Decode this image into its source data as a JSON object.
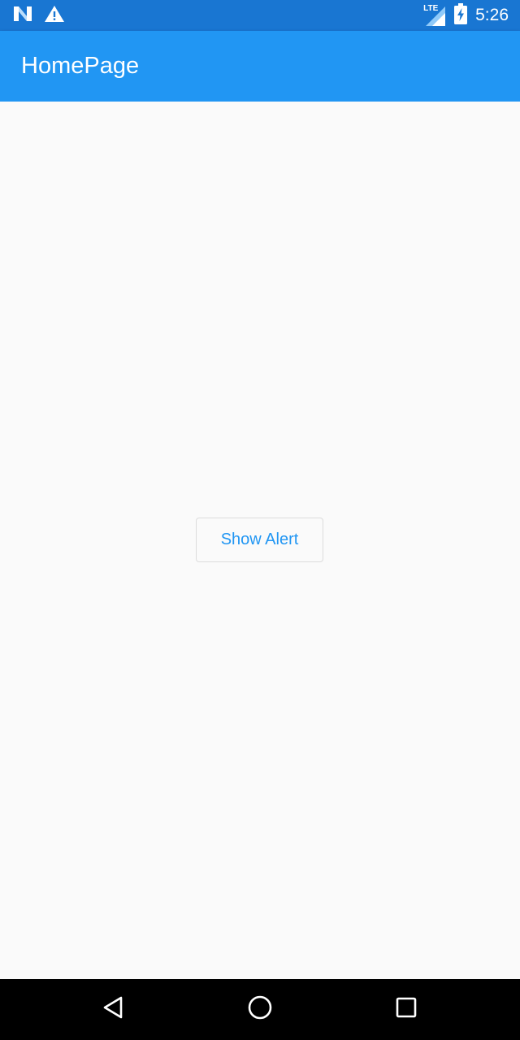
{
  "status_bar": {
    "time": "5:26",
    "network_label": "LTE",
    "icons": [
      "n-logo-icon",
      "warning-icon",
      "lte-signal-icon",
      "battery-charging-icon"
    ]
  },
  "app_bar": {
    "title": "HomePage"
  },
  "main": {
    "button_label": "Show Alert"
  },
  "nav_bar": {
    "icons": [
      "back-icon",
      "home-icon",
      "recents-icon"
    ]
  },
  "colors": {
    "status_bar": "#1976d2",
    "app_bar": "#2196f3",
    "background": "#fafafa",
    "accent": "#2196f3",
    "nav_bar": "#000000"
  }
}
